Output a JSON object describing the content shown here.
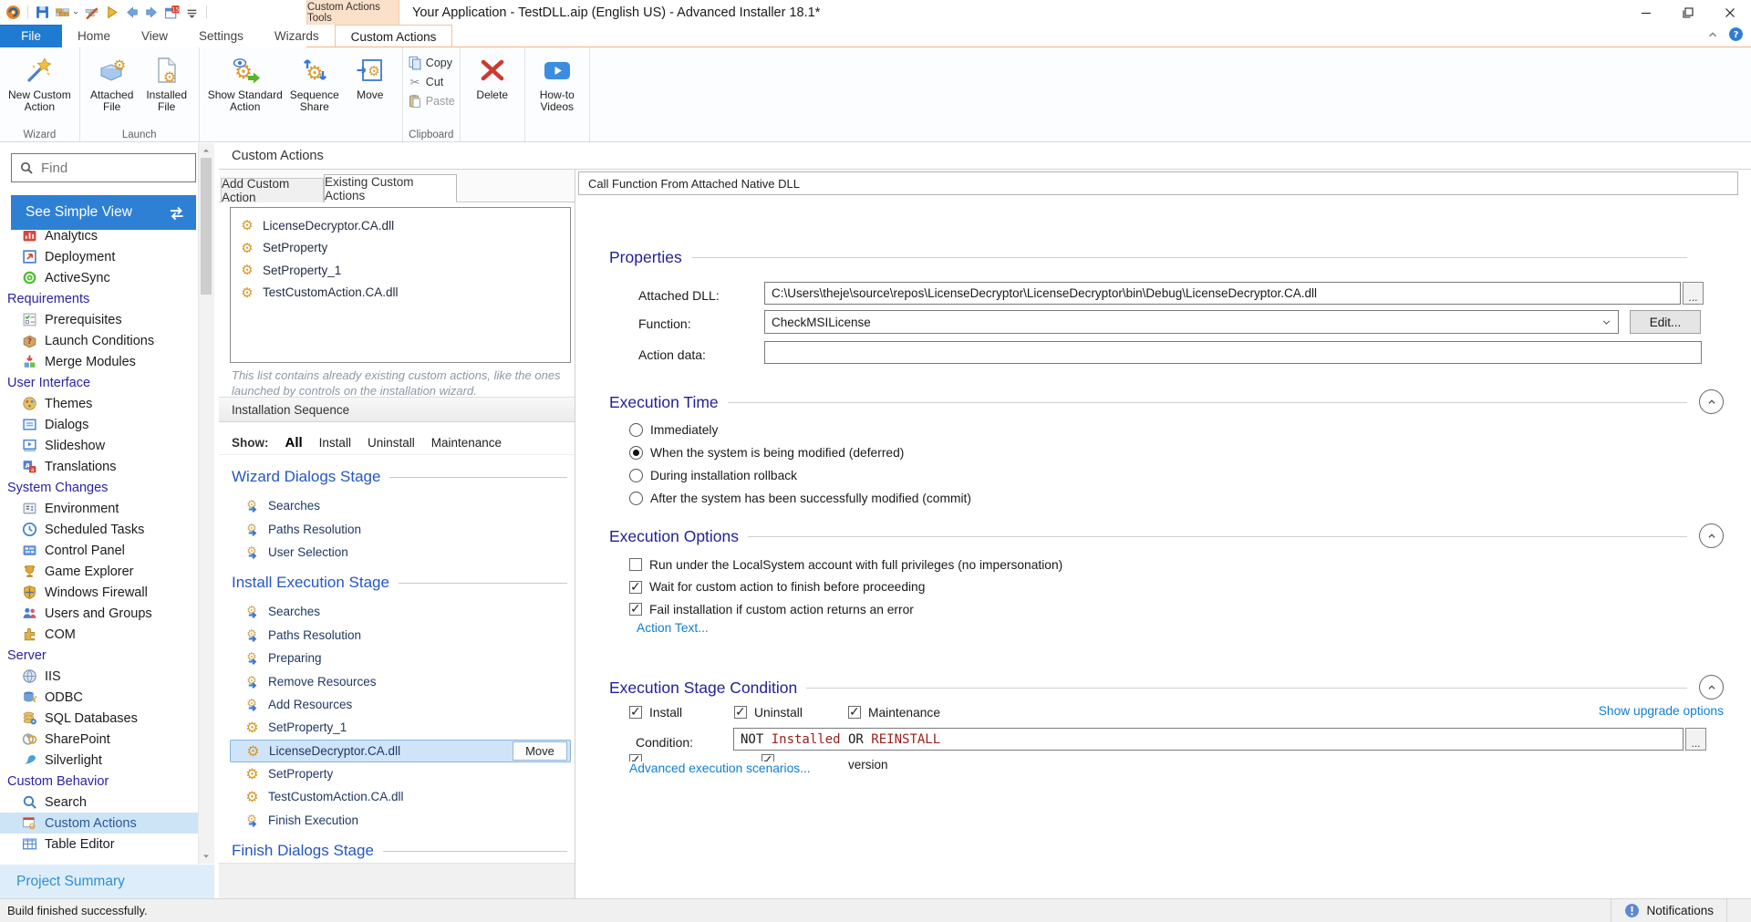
{
  "window": {
    "contextual_group": "Custom Actions Tools",
    "title": "Your Application - TestDLL.aip (English US) - Advanced Installer 18.1*"
  },
  "quick_access": {
    "icons": [
      "app-logo",
      "sep",
      "save",
      "build",
      "rebuild",
      "run",
      "back",
      "forward",
      "whatsnew",
      "customize",
      "sep"
    ],
    "badge": "15"
  },
  "ribbon": {
    "tabs": [
      {
        "label": "File",
        "style": "file"
      },
      {
        "label": "Home"
      },
      {
        "label": "View"
      },
      {
        "label": "Settings"
      },
      {
        "label": "Wizards"
      }
    ],
    "contextual_tab": "Custom Actions",
    "groups": [
      {
        "label": "Wizard",
        "buttons": [
          {
            "lines": [
              "New Custom",
              "Action"
            ],
            "icon": "wand"
          }
        ]
      },
      {
        "label": "Launch",
        "buttons": [
          {
            "lines": [
              "Attached",
              "File"
            ],
            "icon": "attached-file"
          },
          {
            "lines": [
              "Installed",
              "File"
            ],
            "icon": "installed-file"
          }
        ]
      },
      {
        "label": "",
        "buttons": [
          {
            "lines": [
              "Show Standard",
              "Action"
            ],
            "icon": "show-standard"
          },
          {
            "lines": [
              "Sequence",
              "Share"
            ],
            "icon": "sequence-share"
          },
          {
            "lines": [
              "Move"
            ],
            "icon": "move"
          }
        ]
      },
      {
        "label": "Clipboard",
        "small_buttons": [
          {
            "label": "Copy",
            "icon": "copy"
          },
          {
            "label": "Cut",
            "icon": "cut"
          },
          {
            "label": "Paste",
            "icon": "paste",
            "disabled": true
          }
        ]
      },
      {
        "label": "",
        "buttons": [
          {
            "lines": [
              "Delete"
            ],
            "icon": "delete"
          }
        ]
      },
      {
        "label": "",
        "buttons": [
          {
            "lines": [
              "How-to",
              "Videos"
            ],
            "icon": "howto"
          }
        ]
      }
    ]
  },
  "sidebar": {
    "find_placeholder": "Find",
    "simple_view": "See Simple View",
    "tree": [
      {
        "type": "item",
        "label": "Analytics",
        "icon": "analytics"
      },
      {
        "type": "item",
        "label": "Deployment",
        "icon": "deployment"
      },
      {
        "type": "item",
        "label": "ActiveSync",
        "icon": "activesync"
      },
      {
        "type": "header",
        "label": "Requirements"
      },
      {
        "type": "item",
        "label": "Prerequisites",
        "icon": "prerequisites"
      },
      {
        "type": "item",
        "label": "Launch Conditions",
        "icon": "launch-conditions"
      },
      {
        "type": "item",
        "label": "Merge Modules",
        "icon": "merge-modules"
      },
      {
        "type": "header",
        "label": "User Interface"
      },
      {
        "type": "item",
        "label": "Themes",
        "icon": "themes"
      },
      {
        "type": "item",
        "label": "Dialogs",
        "icon": "dialogs"
      },
      {
        "type": "item",
        "label": "Slideshow",
        "icon": "slideshow"
      },
      {
        "type": "item",
        "label": "Translations",
        "icon": "translations"
      },
      {
        "type": "header",
        "label": "System Changes"
      },
      {
        "type": "item",
        "label": "Environment",
        "icon": "environment"
      },
      {
        "type": "item",
        "label": "Scheduled Tasks",
        "icon": "scheduled-tasks"
      },
      {
        "type": "item",
        "label": "Control Panel",
        "icon": "control-panel"
      },
      {
        "type": "item",
        "label": "Game Explorer",
        "icon": "game-explorer"
      },
      {
        "type": "item",
        "label": "Windows Firewall",
        "icon": "windows-firewall"
      },
      {
        "type": "item",
        "label": "Users and Groups",
        "icon": "users-and-groups"
      },
      {
        "type": "item",
        "label": "COM",
        "icon": "com"
      },
      {
        "type": "header",
        "label": "Server"
      },
      {
        "type": "item",
        "label": "IIS",
        "icon": "iis"
      },
      {
        "type": "item",
        "label": "ODBC",
        "icon": "odbc"
      },
      {
        "type": "item",
        "label": "SQL Databases",
        "icon": "sql-databases"
      },
      {
        "type": "item",
        "label": "SharePoint",
        "icon": "sharepoint"
      },
      {
        "type": "item",
        "label": "Silverlight",
        "icon": "silverlight"
      },
      {
        "type": "header",
        "label": "Custom Behavior"
      },
      {
        "type": "item",
        "label": "Search",
        "icon": "search"
      },
      {
        "type": "item",
        "label": "Custom Actions",
        "icon": "custom-actions",
        "selected": true
      },
      {
        "type": "item",
        "label": "Table Editor",
        "icon": "table-editor"
      }
    ],
    "project_summary": "Project Summary"
  },
  "middle": {
    "page_title": "Custom Actions",
    "tabs": [
      {
        "label": "Add Custom Action"
      },
      {
        "label": "Existing Custom Actions",
        "active": true
      }
    ],
    "existing_actions": [
      "LicenseDecryptor.CA.dll",
      "SetProperty",
      "SetProperty_1",
      "TestCustomAction.CA.dll"
    ],
    "note_line1": "This list contains already existing custom actions, like the ones",
    "note_line2": "launched by controls on the installation wizard.",
    "sequence_title": "Installation Sequence",
    "show_label": "Show:",
    "filters": [
      {
        "label": "All",
        "active": true
      },
      {
        "label": "Install"
      },
      {
        "label": "Uninstall"
      },
      {
        "label": "Maintenance"
      }
    ],
    "stages": [
      {
        "title": "Wizard Dialogs Stage",
        "items": [
          {
            "label": "Searches",
            "kind": "stage"
          },
          {
            "label": "Paths Resolution",
            "kind": "stage"
          },
          {
            "label": "User Selection",
            "kind": "stage"
          }
        ]
      },
      {
        "title": "Install Execution Stage",
        "items": [
          {
            "label": "Searches",
            "kind": "stage"
          },
          {
            "label": "Paths Resolution",
            "kind": "stage"
          },
          {
            "label": "Preparing",
            "kind": "stage"
          },
          {
            "label": "Remove Resources",
            "kind": "stage"
          },
          {
            "label": "Add Resources",
            "kind": "stage"
          },
          {
            "label": "SetProperty_1",
            "kind": "action"
          },
          {
            "label": "LicenseDecryptor.CA.dll",
            "kind": "action",
            "selected": true,
            "move_label": "Move"
          },
          {
            "label": "SetProperty",
            "kind": "action"
          },
          {
            "label": "TestCustomAction.CA.dll",
            "kind": "action"
          },
          {
            "label": "Finish Execution",
            "kind": "stage"
          }
        ]
      },
      {
        "title": "Finish Dialogs Stage",
        "items": []
      }
    ]
  },
  "panel": {
    "header": "Call Function From Attached Native DLL",
    "properties": {
      "title": "Properties",
      "attached_dll_label": "Attached DLL:",
      "attached_dll_value": "C:\\Users\\theje\\source\\repos\\LicenseDecryptor\\LicenseDecryptor\\bin\\Debug\\LicenseDecryptor.CA.dll",
      "browse_label": "...",
      "function_label": "Function:",
      "function_value": "CheckMSILicense",
      "edit_label": "Edit...",
      "action_data_label": "Action data:",
      "action_data_value": ""
    },
    "execution_time": {
      "title": "Execution Time",
      "options": [
        {
          "label": "Immediately"
        },
        {
          "label": "When the system is being modified (deferred)",
          "selected": true
        },
        {
          "label": "During installation rollback"
        },
        {
          "label": "After the system has been successfully modified (commit)"
        }
      ]
    },
    "execution_options": {
      "title": "Execution Options",
      "checkboxes": [
        {
          "label": "Run under the LocalSystem account with full privileges (no impersonation)",
          "checked": false
        },
        {
          "label": "Wait for custom action to finish before proceeding",
          "checked": true
        },
        {
          "label": "Fail installation if custom action returns an error",
          "checked": true
        }
      ],
      "action_text_link": "Action Text..."
    },
    "stage_condition": {
      "title": "Execution Stage Condition",
      "checkboxes": [
        {
          "label": "Install",
          "checked": true
        },
        {
          "label": "Uninstall",
          "checked": true
        },
        {
          "label": "Maintenance",
          "checked": true
        }
      ],
      "upgrade_link": "Show upgrade options",
      "condition_label": "Condition:",
      "condition_parts": [
        {
          "text": "NOT ",
          "color": "#1a1a1a"
        },
        {
          "text": "Installed",
          "color": "#99201c"
        },
        {
          "text": " OR ",
          "color": "#1a1a1a"
        },
        {
          "text": "REINSTALL",
          "color": "#99201c"
        }
      ],
      "browse_label": "...",
      "version_fragment": "version",
      "advanced_link": "Advanced execution scenarios..."
    }
  },
  "status": {
    "message": "Build finished successfully.",
    "notifications": "Notifications"
  }
}
